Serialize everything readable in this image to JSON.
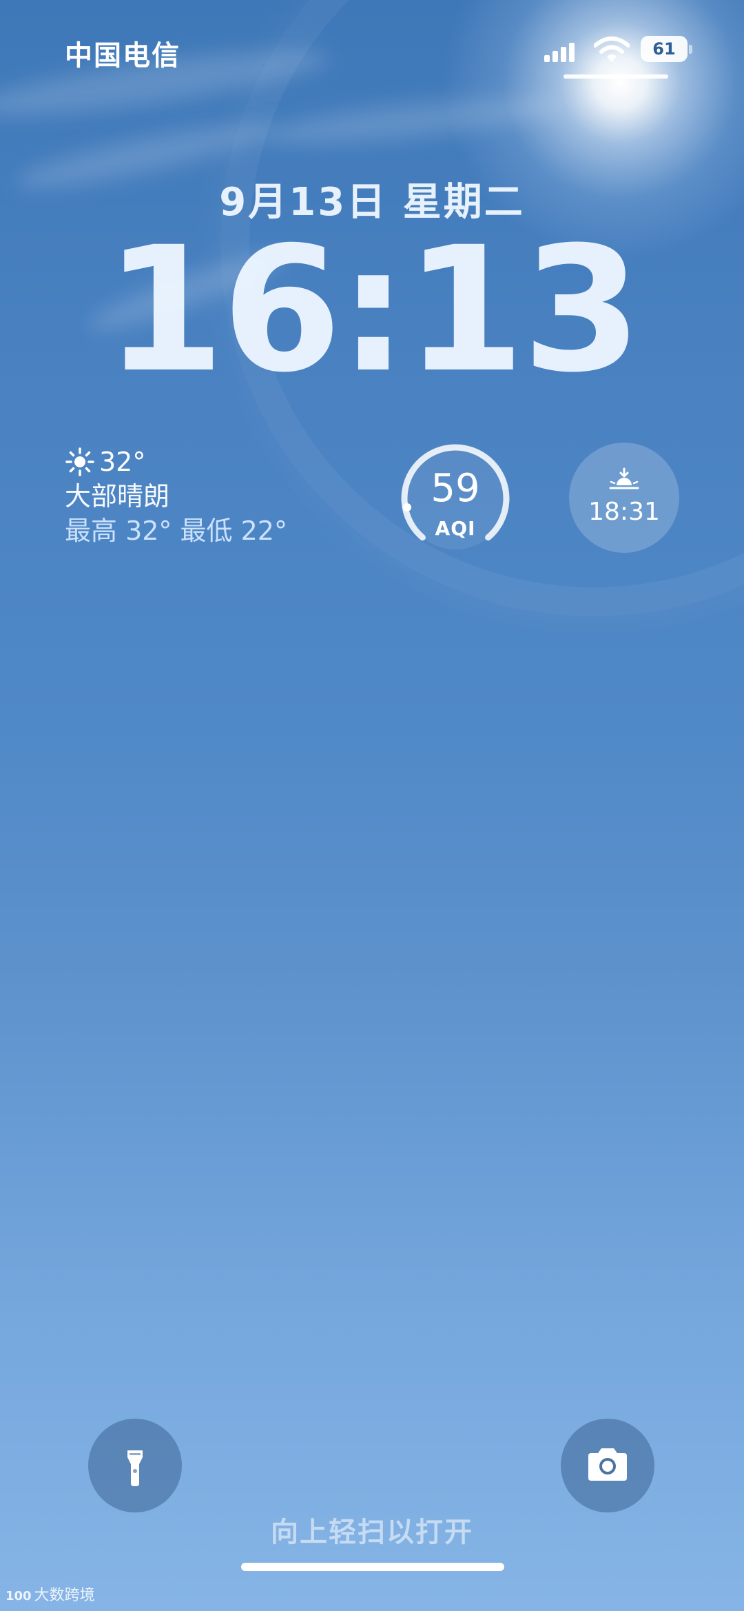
{
  "status_bar": {
    "carrier": "中国电信",
    "battery_level": "61",
    "icons": [
      "cellular-signal-icon",
      "wifi-icon",
      "battery-icon"
    ]
  },
  "lock_screen": {
    "date": "9月13日 星期二",
    "time": "16:13"
  },
  "widgets": {
    "weather": {
      "icon": "sun-icon",
      "temperature": "32°",
      "condition": "大部晴朗",
      "range": "最高 32° 最低 22°"
    },
    "aqi": {
      "value": "59",
      "label": "AQI"
    },
    "sunset": {
      "icon": "sunset-icon",
      "time": "18:31"
    }
  },
  "bottom": {
    "flashlight_icon": "flashlight-icon",
    "camera_icon": "camera-icon",
    "swipe_hint": "向上轻扫以打开"
  },
  "watermark": {
    "logo": "100",
    "text": "大数跨境"
  },
  "colors": {
    "sky_top": "#3f78b8",
    "sky_bottom": "#86b4e6",
    "text": "#ffffff"
  }
}
